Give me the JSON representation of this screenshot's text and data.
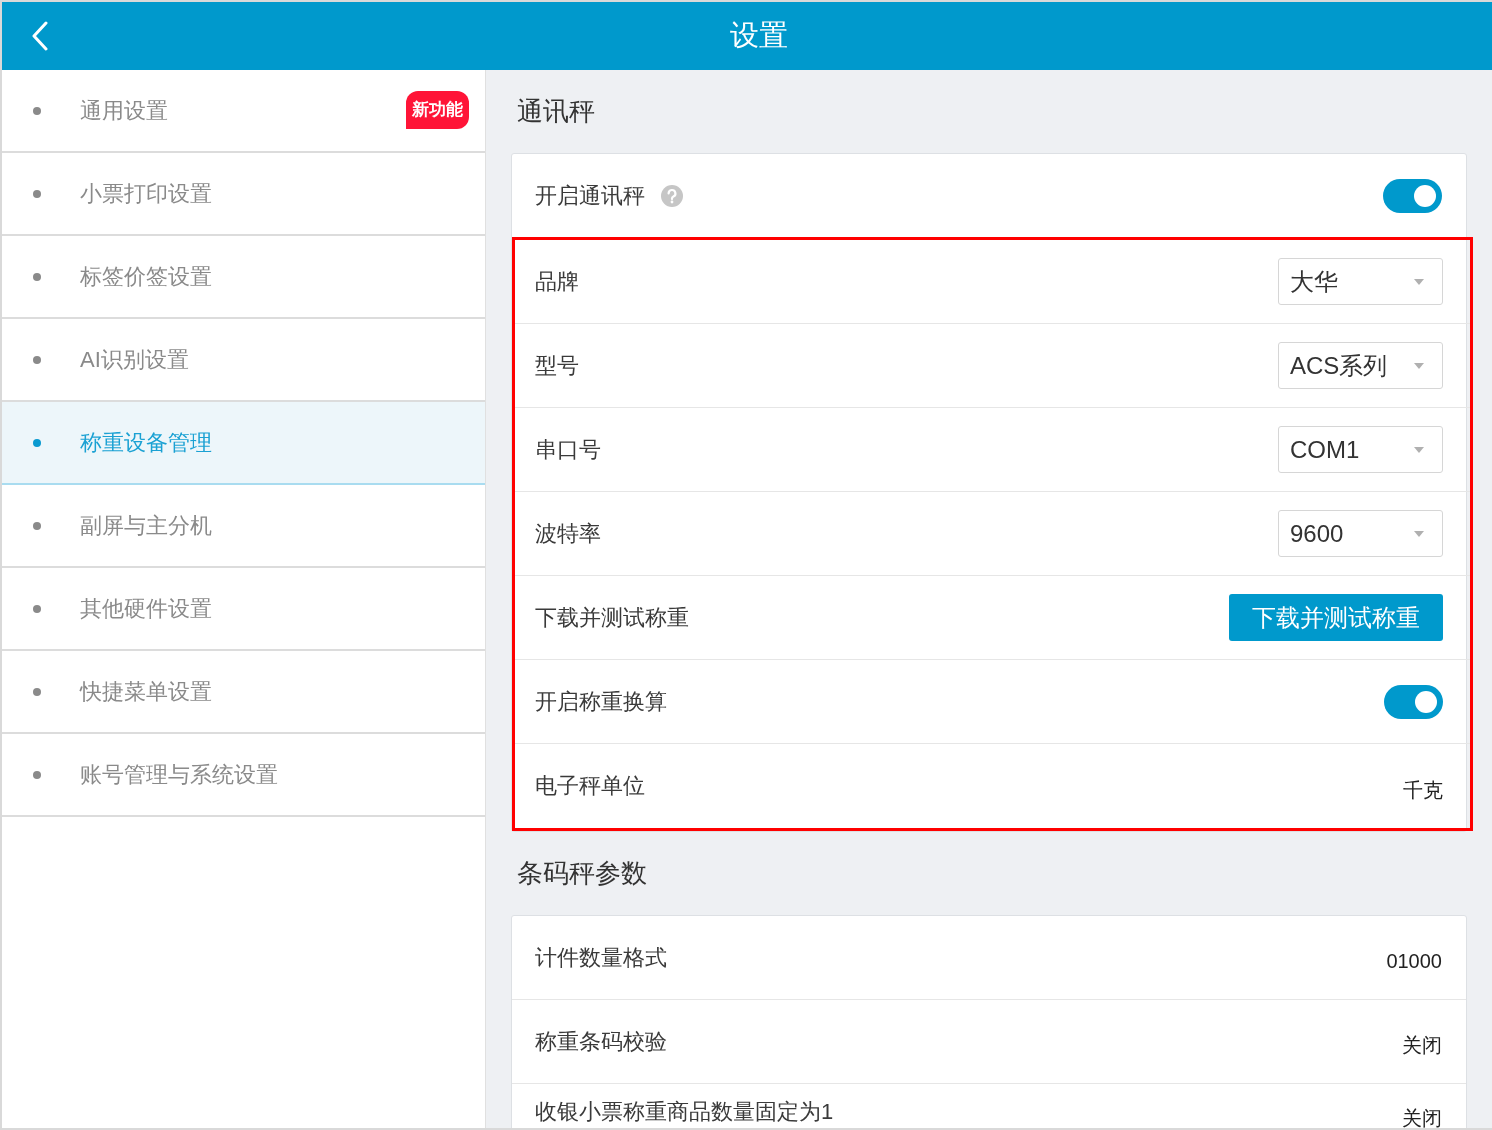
{
  "header": {
    "title": "设置"
  },
  "sidebar": {
    "items": [
      {
        "label": "通用设置",
        "selected": false,
        "badge": "新功能"
      },
      {
        "label": "小票打印设置",
        "selected": false
      },
      {
        "label": "标签价签设置",
        "selected": false
      },
      {
        "label": "AI识别设置",
        "selected": false
      },
      {
        "label": "称重设备管理",
        "selected": true
      },
      {
        "label": "副屏与主分机",
        "selected": false
      },
      {
        "label": "其他硬件设置",
        "selected": false
      },
      {
        "label": "快捷菜单设置",
        "selected": false
      },
      {
        "label": "账号管理与系统设置",
        "selected": false
      }
    ]
  },
  "sections": [
    {
      "title": "通讯秤",
      "rows": [
        {
          "kind": "toggle",
          "label": "开启通讯秤",
          "help": true,
          "on": true
        }
      ],
      "highlighted_rows": [
        {
          "kind": "select",
          "label": "品牌",
          "value": "大华"
        },
        {
          "kind": "select",
          "label": "型号",
          "value": "ACS系列"
        },
        {
          "kind": "select",
          "label": "串口号",
          "value": "COM1"
        },
        {
          "kind": "select",
          "label": "波特率",
          "value": "9600"
        },
        {
          "kind": "button",
          "label": "下载并测试称重",
          "button": "下载并测试称重"
        },
        {
          "kind": "toggle",
          "label": "开启称重换算",
          "on": true
        },
        {
          "kind": "text",
          "label": "电子秤单位",
          "value": "千克"
        }
      ]
    },
    {
      "title": "条码秤参数",
      "rows": [
        {
          "kind": "text",
          "label": "计件数量格式",
          "value": "01000"
        },
        {
          "kind": "text",
          "label": "称重条码校验",
          "value": "关闭"
        },
        {
          "kind": "text",
          "label": "收银小票称重商品数量固定为1",
          "value": "关闭"
        }
      ]
    }
  ]
}
